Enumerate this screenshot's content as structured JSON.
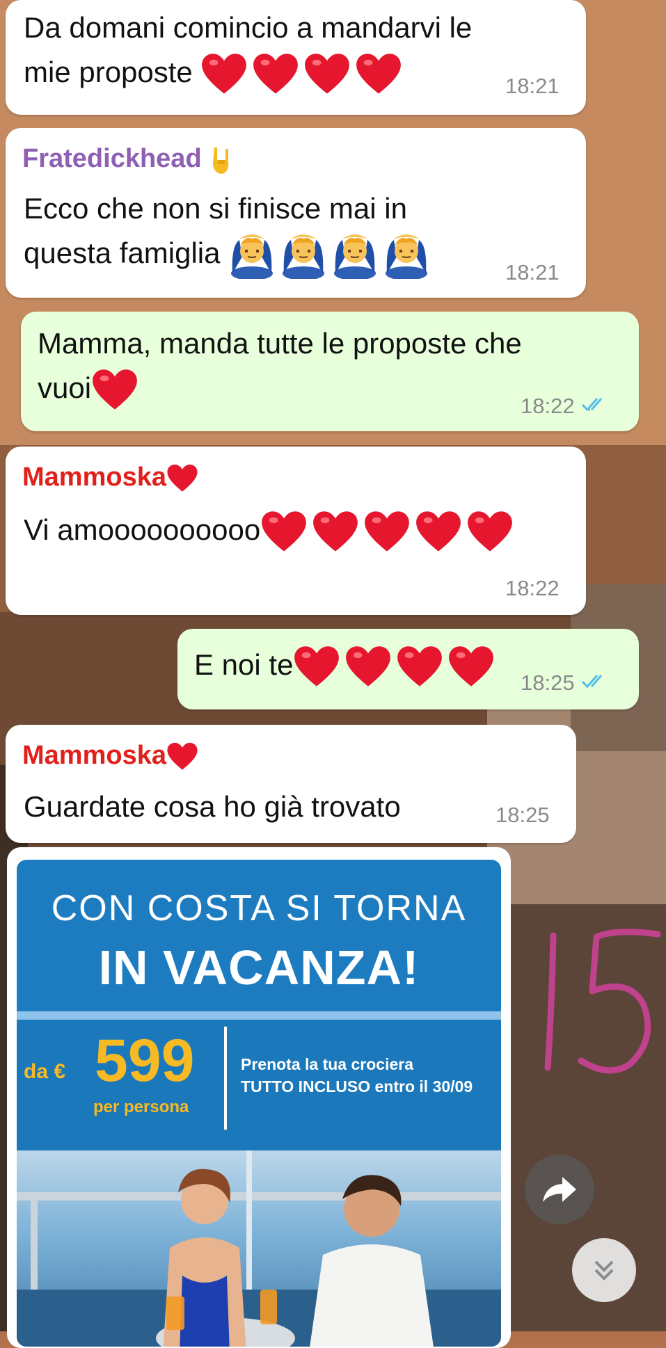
{
  "messages": [
    {
      "text_line1": "Da domani comincio a mandarvi le",
      "text_line2": "mie proposte",
      "time": "18:21"
    },
    {
      "sender": "Fratedickhead",
      "text_line1": "Ecco che non si finisce mai in",
      "text_line2": "questa famiglia",
      "time": "18:21"
    },
    {
      "text_line1": "Mamma, manda tutte le proposte che",
      "text_line2": "vuoi",
      "time": "18:22"
    },
    {
      "sender": "Mammoska",
      "text": "Vi amoooooooooo",
      "time": "18:22"
    },
    {
      "text": "E noi te",
      "time": "18:25"
    },
    {
      "sender": "Mammoska",
      "text": "Guardate cosa ho già trovato",
      "time": "18:25"
    }
  ],
  "promo": {
    "line1": "CON COSTA SI TORNA",
    "line2": "IN VACANZA!",
    "price_prefix": "da €",
    "price": "599",
    "price_suffix": "per persona",
    "note_line1": "Prenota la tua crociera",
    "note_line2": "TUTTO INCLUSO entro il 30/09"
  },
  "handwritten_annotation": "15",
  "colors": {
    "incoming_bubble": "#ffffff",
    "outgoing_bubble": "#e7ffdb",
    "sender_fratedickhead": "#8e5fb3",
    "sender_mammoska": "#e0201c",
    "read_ticks": "#53bdeb",
    "heart": "#e5162d"
  },
  "icons": [
    "heart-emoji",
    "rock-on-emoji",
    "facepalm-person-emoji",
    "double-check-icon",
    "share-forward-icon",
    "scroll-down-icon"
  ]
}
